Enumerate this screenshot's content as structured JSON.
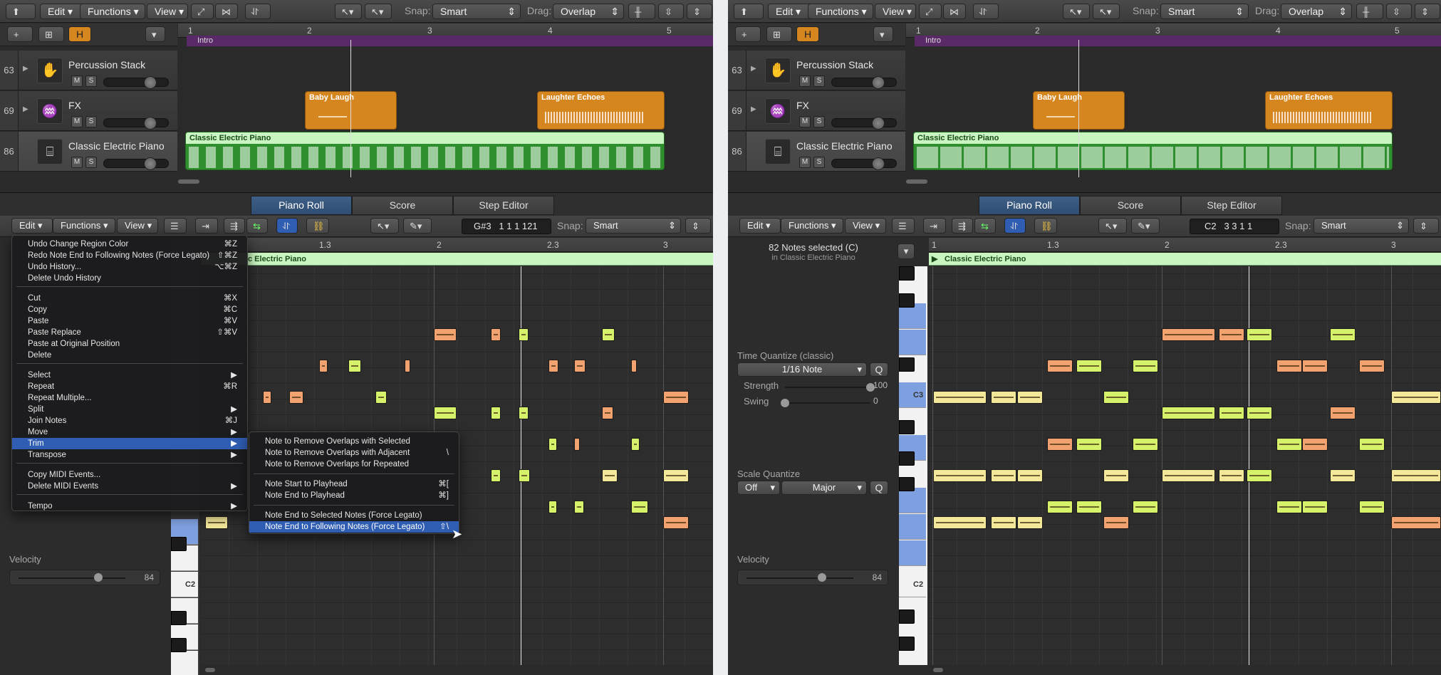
{
  "panels": [
    {
      "main": {
        "menus": [
          "Edit",
          "Functions",
          "View"
        ],
        "snap_label": "Snap:",
        "snap_value": "Smart",
        "drag_label": "Drag:",
        "drag_value": "Overlap",
        "h_button": "H",
        "ruler": [
          "1",
          "2",
          "3",
          "4",
          "5"
        ],
        "marker": "Intro",
        "tracks": [
          {
            "number": "63",
            "name": "Percussion Stack",
            "m": "M",
            "s": "S"
          },
          {
            "number": "69",
            "name": "FX",
            "m": "M",
            "s": "S"
          },
          {
            "number": "86",
            "name": "Classic Electric Piano",
            "m": "M",
            "s": "S"
          }
        ],
        "regions": [
          "Baby Laugh",
          "Laughter Echoes",
          "Classic Electric Piano"
        ]
      },
      "editor": {
        "tabs": [
          "Piano Roll",
          "Score",
          "Step Editor"
        ],
        "menus": [
          "Edit",
          "Functions",
          "View"
        ],
        "position": "G#3   1 1 1 121",
        "snap_label": "Snap:",
        "snap_value": "Smart",
        "ruler": [
          "1.3",
          "2",
          "2.3",
          "3"
        ],
        "region_name": "c Electric Piano",
        "velocity_label": "Velocity",
        "velocity_value": "84",
        "c2": "C2",
        "edit_menu": [
          {
            "label": "Undo Change Region Color",
            "shortcut": "⌘Z"
          },
          {
            "label": "Redo Note End to Following Notes (Force Legato)",
            "shortcut": "⇧⌘Z"
          },
          {
            "label": "Undo History...",
            "shortcut": "⌥⌘Z"
          },
          {
            "label": "Delete Undo History",
            "shortcut": ""
          },
          {
            "label": "Cut",
            "shortcut": "⌘X"
          },
          {
            "label": "Copy",
            "shortcut": "⌘C"
          },
          {
            "label": "Paste",
            "shortcut": "⌘V"
          },
          {
            "label": "Paste Replace",
            "shortcut": "⇧⌘V"
          },
          {
            "label": "Paste at Original Position",
            "shortcut": ""
          },
          {
            "label": "Delete",
            "shortcut": ""
          },
          {
            "label": "Select",
            "shortcut": "▶"
          },
          {
            "label": "Repeat",
            "shortcut": "⌘R"
          },
          {
            "label": "Repeat Multiple...",
            "shortcut": ""
          },
          {
            "label": "Split",
            "shortcut": "▶"
          },
          {
            "label": "Join Notes",
            "shortcut": "⌘J"
          },
          {
            "label": "Move",
            "shortcut": "▶"
          },
          {
            "label": "Trim",
            "shortcut": "▶"
          },
          {
            "label": "Transpose",
            "shortcut": "▶"
          },
          {
            "label": "Copy MIDI Events...",
            "shortcut": ""
          },
          {
            "label": "Delete MIDI Events",
            "shortcut": "▶"
          },
          {
            "label": "Tempo",
            "shortcut": "▶"
          }
        ],
        "trim_menu": [
          {
            "label": "Note to Remove Overlaps with Selected",
            "shortcut": ""
          },
          {
            "label": "Note to Remove Overlaps with Adjacent",
            "shortcut": "\\"
          },
          {
            "label": "Note to Remove Overlaps for Repeated",
            "shortcut": ""
          },
          {
            "label": "Note Start to Playhead",
            "shortcut": "⌘["
          },
          {
            "label": "Note End to Playhead",
            "shortcut": "⌘]"
          },
          {
            "label": "Note End to Selected Notes (Force Legato)",
            "shortcut": ""
          },
          {
            "label": "Note End to Following Notes (Force Legato)",
            "shortcut": "⇧\\"
          }
        ]
      }
    },
    {
      "main": {
        "menus": [
          "Edit",
          "Functions",
          "View"
        ],
        "snap_label": "Snap:",
        "snap_value": "Smart",
        "drag_label": "Drag:",
        "drag_value": "Overlap",
        "h_button": "H",
        "ruler": [
          "1",
          "2",
          "3",
          "4",
          "5"
        ],
        "marker": "Intro",
        "tracks": [
          {
            "number": "63",
            "name": "Percussion Stack",
            "m": "M",
            "s": "S"
          },
          {
            "number": "69",
            "name": "FX",
            "m": "M",
            "s": "S"
          },
          {
            "number": "86",
            "name": "Classic Electric Piano",
            "m": "M",
            "s": "S"
          }
        ],
        "regions": [
          "Baby Laugh",
          "Laughter Echoes",
          "Classic Electric Piano"
        ]
      },
      "editor": {
        "tabs": [
          "Piano Roll",
          "Score",
          "Step Editor"
        ],
        "menus": [
          "Edit",
          "Functions",
          "View"
        ],
        "position": "C2   3 3 1 1",
        "snap_label": "Snap:",
        "snap_value": "Smart",
        "ruler": [
          "1",
          "1.3",
          "2",
          "2.3",
          "3"
        ],
        "region_name": "Classic Electric Piano",
        "selection_info": "82 Notes selected (C)",
        "selection_sub": "in Classic Electric Piano",
        "time_quantize_label": "Time Quantize (classic)",
        "quantize_value": "1/16 Note",
        "q": "Q",
        "strength_label": "Strength",
        "strength_value": "100",
        "swing_label": "Swing",
        "swing_value": "0",
        "scale_quantize_label": "Scale Quantize",
        "scale_off": "Off",
        "scale_major": "Major",
        "velocity_label": "Velocity",
        "velocity_value": "84",
        "c3": "C3",
        "c2": "C2"
      }
    }
  ],
  "colors": {
    "note_yellow": "#f3e79a",
    "note_green": "#d6f26a",
    "note_orange": "#f2a26e",
    "region_green": "#2f8f2f",
    "region_orange": "#d6861e",
    "marker_purple": "#5a2a68",
    "selection_blue": "#2f5db2"
  }
}
